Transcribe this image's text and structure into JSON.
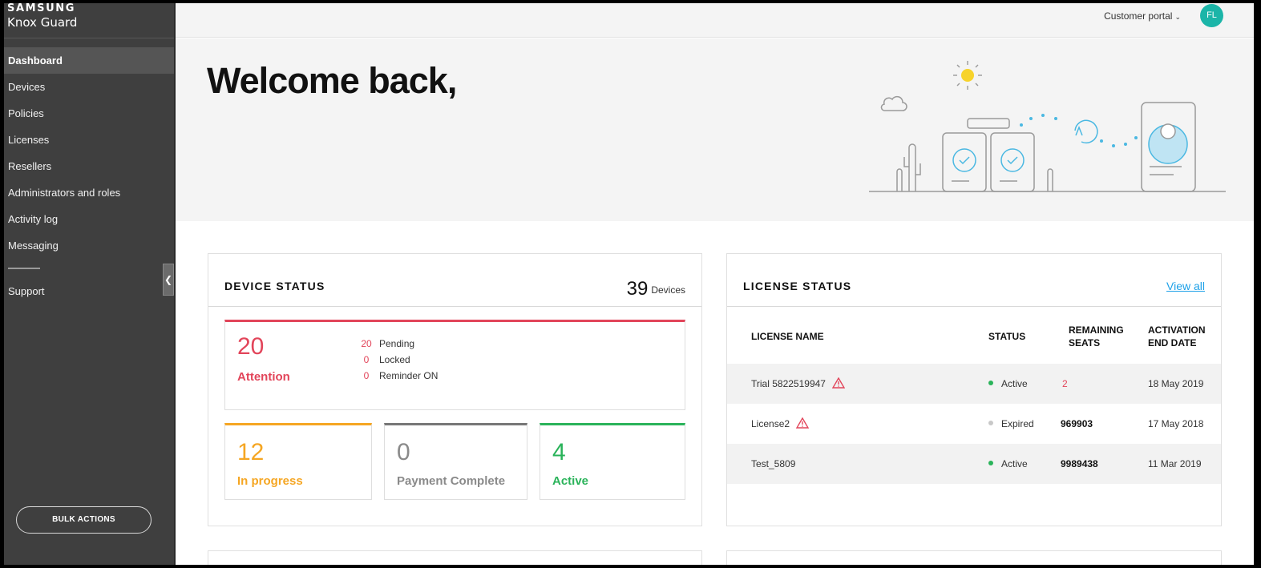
{
  "brand": {
    "company": "SAMSUNG",
    "product": "Knox Guard"
  },
  "sidebar": {
    "items": [
      {
        "label": "Dashboard"
      },
      {
        "label": "Devices"
      },
      {
        "label": "Policies"
      },
      {
        "label": "Licenses"
      },
      {
        "label": "Resellers"
      },
      {
        "label": "Administrators and roles"
      },
      {
        "label": "Activity log"
      },
      {
        "label": "Messaging"
      }
    ],
    "active": "Dashboard",
    "support": "Support",
    "bulk_actions": "BULK ACTIONS"
  },
  "topbar": {
    "portal_label": "Customer portal",
    "avatar_initials": "FL",
    "avatar_color": "#1bb5a8"
  },
  "hero": {
    "welcome": "Welcome back,"
  },
  "device_status": {
    "title": "DEVICE STATUS",
    "count": "39",
    "count_unit": "Devices",
    "attention": {
      "value": "20",
      "label": "Attention",
      "breakdown": [
        {
          "value": "20",
          "label": "Pending"
        },
        {
          "value": "0",
          "label": "Locked"
        },
        {
          "value": "0",
          "label": "Reminder ON"
        }
      ]
    },
    "in_progress": {
      "value": "12",
      "label": "In progress"
    },
    "payment_complete": {
      "value": "0",
      "label": "Payment Complete"
    },
    "active": {
      "value": "4",
      "label": "Active"
    }
  },
  "license_status": {
    "title": "LICENSE STATUS",
    "view_all": "View all",
    "columns": {
      "name": "LICENSE NAME",
      "status": "STATUS",
      "remaining_1": "REMAINING",
      "remaining_2": "SEATS",
      "end_1": "ACTIVATION",
      "end_2": "END DATE"
    },
    "rows": [
      {
        "name": "Trial 5822519947",
        "warning": true,
        "status": "Active",
        "seats": "2",
        "end_date": "18 May 2019"
      },
      {
        "name": "License2",
        "warning": true,
        "status": "Expired",
        "seats": "969903",
        "end_date": "17 May 2018"
      },
      {
        "name": "Test_5809",
        "warning": false,
        "status": "Active",
        "seats": "9989438",
        "end_date": "11 Mar 2019"
      }
    ]
  },
  "colors": {
    "attention": "#e2455a",
    "in_progress": "#f5a623",
    "payment_complete": "#777777",
    "active": "#2ab35a",
    "link": "#1ea1e8",
    "sidebar": "#3f3f3f"
  }
}
